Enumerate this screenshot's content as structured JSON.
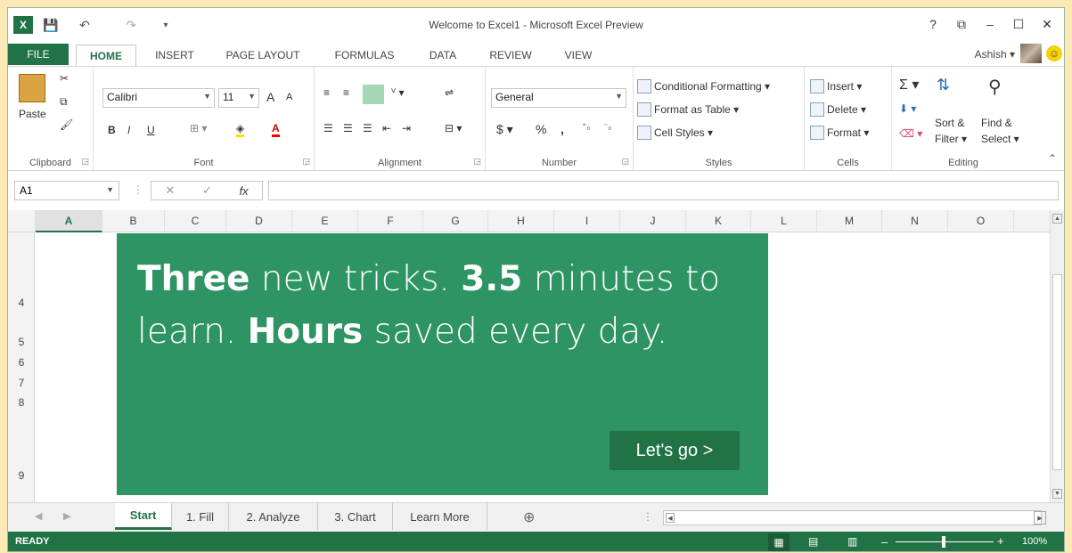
{
  "window": {
    "title": "Welcome to Excel1 - Microsoft Excel Preview",
    "help_glyph": "?",
    "restore_glyph": "⧉",
    "minimize_glyph": "–",
    "maximize_glyph": "☐",
    "close_glyph": "✕"
  },
  "quick_access": {
    "excel_glyph": "X",
    "save_glyph": "💾",
    "undo_glyph": "↶",
    "redo_glyph": "↷",
    "more_glyph": "▾"
  },
  "ribbon_tabs": [
    {
      "label": "FILE"
    },
    {
      "label": "HOME"
    },
    {
      "label": "INSERT"
    },
    {
      "label": "PAGE LAYOUT"
    },
    {
      "label": "FORMULAS"
    },
    {
      "label": "DATA"
    },
    {
      "label": "REVIEW"
    },
    {
      "label": "VIEW"
    }
  ],
  "user": {
    "name": "Ashish ▾",
    "smiley": "☺"
  },
  "groups": {
    "clipboard": {
      "label": "Clipboard",
      "paste": "Paste"
    },
    "font": {
      "label": "Font",
      "font_name": "Calibri",
      "font_size": "11",
      "grow": "A",
      "shrink": "A",
      "bold": "B",
      "italic": "I",
      "underline": "U"
    },
    "alignment": {
      "label": "Alignment"
    },
    "number": {
      "label": "Number",
      "format": "General",
      "currency": "$ ▾",
      "percent": "%",
      "comma": ","
    },
    "styles": {
      "label": "Styles",
      "conditional": "Conditional Formatting ▾",
      "table": "Format as Table ▾",
      "cell_styles": "Cell Styles ▾"
    },
    "cells": {
      "label": "Cells",
      "insert": "Insert ▾",
      "delete": "Delete ▾",
      "format": "Format ▾"
    },
    "editing": {
      "label": "Editing",
      "sort_line1": "Sort &",
      "sort_line2": "Filter ▾",
      "find_line1": "Find &",
      "find_line2": "Select ▾",
      "sigma": "Σ ▾"
    }
  },
  "formula_bar": {
    "name_box": "A1",
    "cancel": "✕",
    "enter": "✓",
    "fx": "fx"
  },
  "columns": [
    "A",
    "B",
    "C",
    "D",
    "E",
    "F",
    "G",
    "H",
    "I",
    "J",
    "K",
    "L",
    "M",
    "N",
    "O"
  ],
  "rows": [
    "4",
    "5",
    "6",
    "7",
    "8",
    "9"
  ],
  "banner": {
    "w1": "Three",
    "t1": " new tricks. ",
    "w2": "3.5",
    "t2": " minutes to learn. ",
    "w3": "Hours",
    "t3": " saved every day.",
    "button": "Let's go >"
  },
  "sheets": [
    {
      "label": "Start"
    },
    {
      "label": "1. Fill"
    },
    {
      "label": "2. Analyze"
    },
    {
      "label": "3. Chart"
    },
    {
      "label": "Learn More"
    }
  ],
  "add_sheet": "⊕",
  "status": {
    "ready": "READY",
    "zoom": "100%"
  },
  "colors": {
    "accent": "#217346",
    "banner": "#2e9464"
  }
}
